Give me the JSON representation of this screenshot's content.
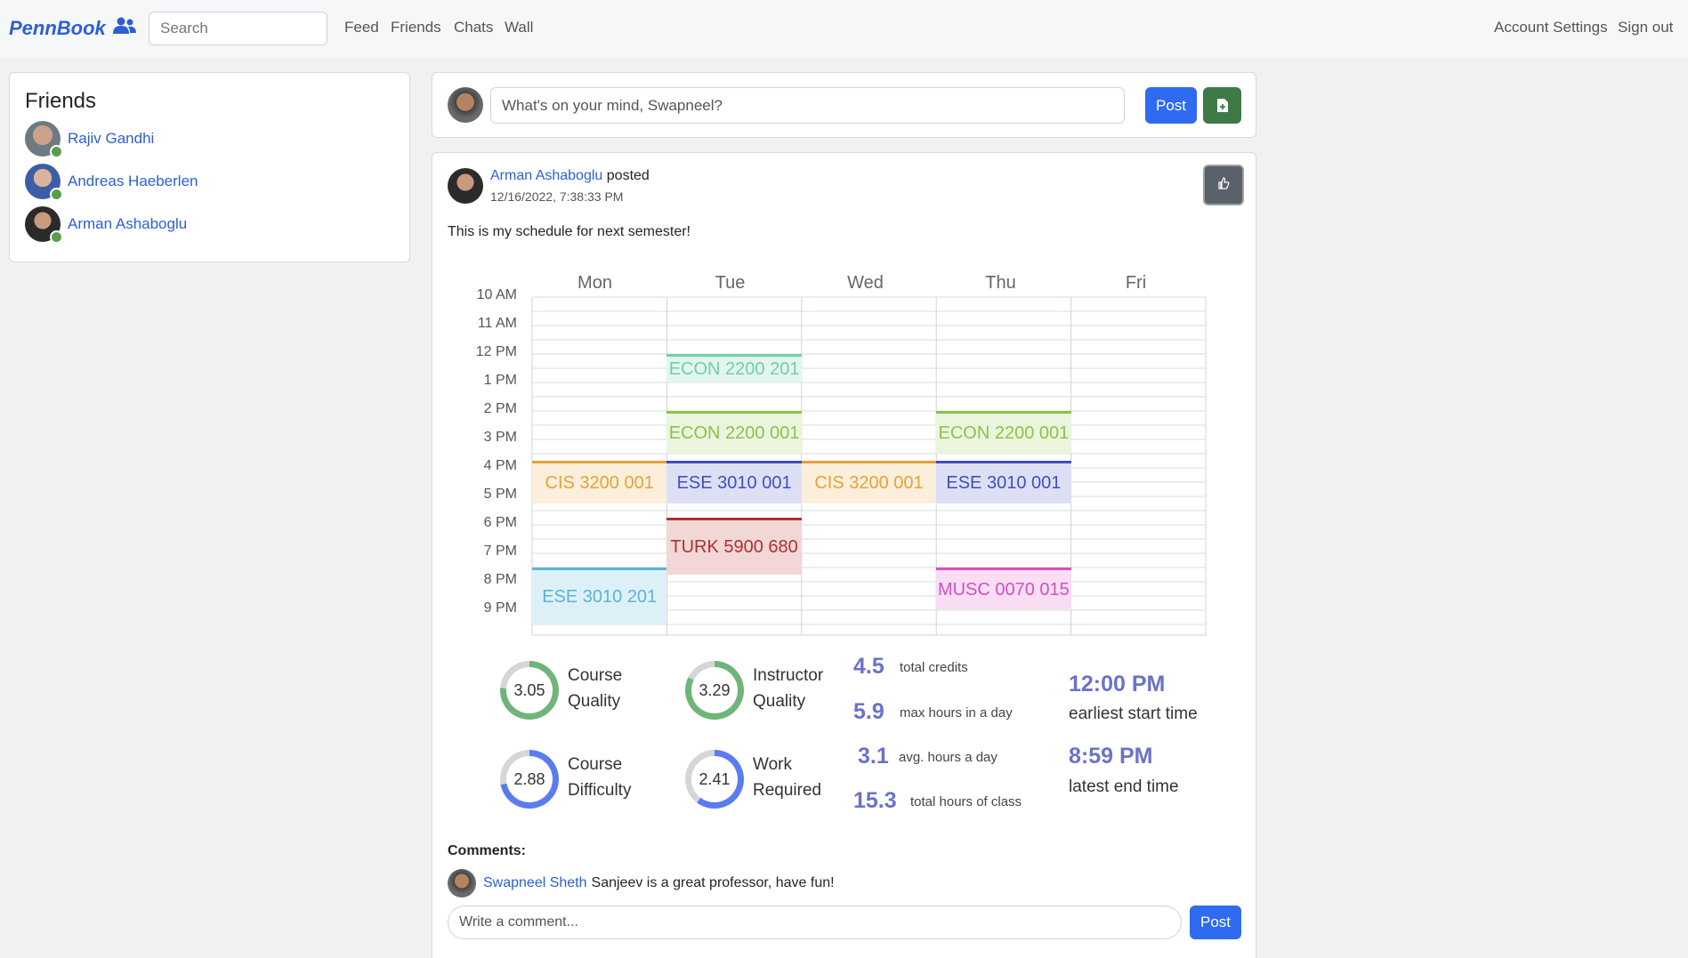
{
  "navbar": {
    "brand": "PennBook",
    "brand_icon": "users-icon",
    "search_placeholder": "Search",
    "links": [
      "Feed",
      "Friends",
      "Chats",
      "Wall"
    ],
    "account_settings": "Account Settings",
    "sign_out": "Sign out"
  },
  "friends": {
    "title": "Friends",
    "items": [
      {
        "name": "Rajiv Gandhi",
        "online": true
      },
      {
        "name": "Andreas Haeberlen",
        "online": true
      },
      {
        "name": "Arman Ashaboglu",
        "online": true
      }
    ]
  },
  "composer": {
    "placeholder": "What's on your mind, Swapneel?",
    "post_label": "Post",
    "attach_icon": "file-add-icon"
  },
  "post": {
    "author": "Arman Ashaboglu",
    "verb": "posted",
    "timestamp": "12/16/2022, 7:38:33 PM",
    "like_icon": "thumbs-up-icon",
    "text": "This is my schedule for next semester!",
    "schedule": {
      "days": [
        "Mon",
        "Tue",
        "Wed",
        "Thu",
        "Fri"
      ],
      "times": [
        "10 AM",
        "11 AM",
        "12 PM",
        "1 PM",
        "2 PM",
        "3 PM",
        "4 PM",
        "5 PM",
        "6 PM",
        "7 PM",
        "8 PM",
        "9 PM"
      ],
      "courses": [
        {
          "label": "ECON 2200 201",
          "day": 1,
          "start": 12.0,
          "end": 13.0,
          "color": "#6fcfa9",
          "bg": "#e3f6ee"
        },
        {
          "label": "ECON 2200 001",
          "day": 1,
          "start": 14.0,
          "end": 15.5,
          "color": "#8bc34a",
          "bg": "#ebf5dd"
        },
        {
          "label": "ECON 2200 001",
          "day": 3,
          "start": 14.0,
          "end": 15.5,
          "color": "#8bc34a",
          "bg": "#ebf5dd"
        },
        {
          "label": "CIS 3200 001",
          "day": 0,
          "start": 15.75,
          "end": 17.25,
          "color": "#e3a33a",
          "bg": "#fbeedb"
        },
        {
          "label": "CIS 3200 001",
          "day": 2,
          "start": 15.75,
          "end": 17.25,
          "color": "#e3a33a",
          "bg": "#fbeedb"
        },
        {
          "label": "ESE 3010 001",
          "day": 1,
          "start": 15.75,
          "end": 17.25,
          "color": "#3f4fc0",
          "bg": "#dde0f5"
        },
        {
          "label": "ESE 3010 001",
          "day": 3,
          "start": 15.75,
          "end": 17.25,
          "color": "#3f4fc0",
          "bg": "#dde0f5"
        },
        {
          "label": "TURK 5900 680",
          "day": 1,
          "start": 17.75,
          "end": 19.75,
          "color": "#b03030",
          "bg": "#f1d7d6"
        },
        {
          "label": "ESE 3010 201",
          "day": 0,
          "start": 19.5,
          "end": 21.5,
          "color": "#5ab4d6",
          "bg": "#def0f7"
        },
        {
          "label": "MUSC 0070 015",
          "day": 3,
          "start": 19.5,
          "end": 20.98,
          "color": "#d54fc4",
          "bg": "#f8ddf3"
        }
      ]
    },
    "ratings": [
      {
        "value": "3.05",
        "score": 3.05,
        "label1": "Course",
        "label2": "Quality",
        "color": "#6fb57a"
      },
      {
        "value": "3.29",
        "score": 3.29,
        "label1": "Instructor",
        "label2": "Quality",
        "color": "#6fb57a"
      },
      {
        "value": "2.88",
        "score": 2.88,
        "label1": "Course",
        "label2": "Difficulty",
        "color": "#5b7cf0"
      },
      {
        "value": "2.41",
        "score": 2.41,
        "label1": "Work",
        "label2": "Required",
        "color": "#5b7cf0"
      }
    ],
    "stats": [
      {
        "value": "4.5",
        "label": "total credits"
      },
      {
        "value": "5.9",
        "label": "max hours in a day"
      },
      {
        "value": "3.1",
        "label": "avg. hours a day"
      },
      {
        "value": "15.3",
        "label": "total hours of class"
      }
    ],
    "times": [
      {
        "value": "12:00 PM",
        "label": "earliest start time"
      },
      {
        "value": "8:59 PM",
        "label": "latest end time"
      }
    ],
    "comments_title": "Comments:",
    "comments": [
      {
        "author": "Swapneel Sheth",
        "text": "Sanjeev is a great professor, have fun!"
      }
    ],
    "comment_placeholder": "Write a comment...",
    "comment_post_label": "Post"
  }
}
